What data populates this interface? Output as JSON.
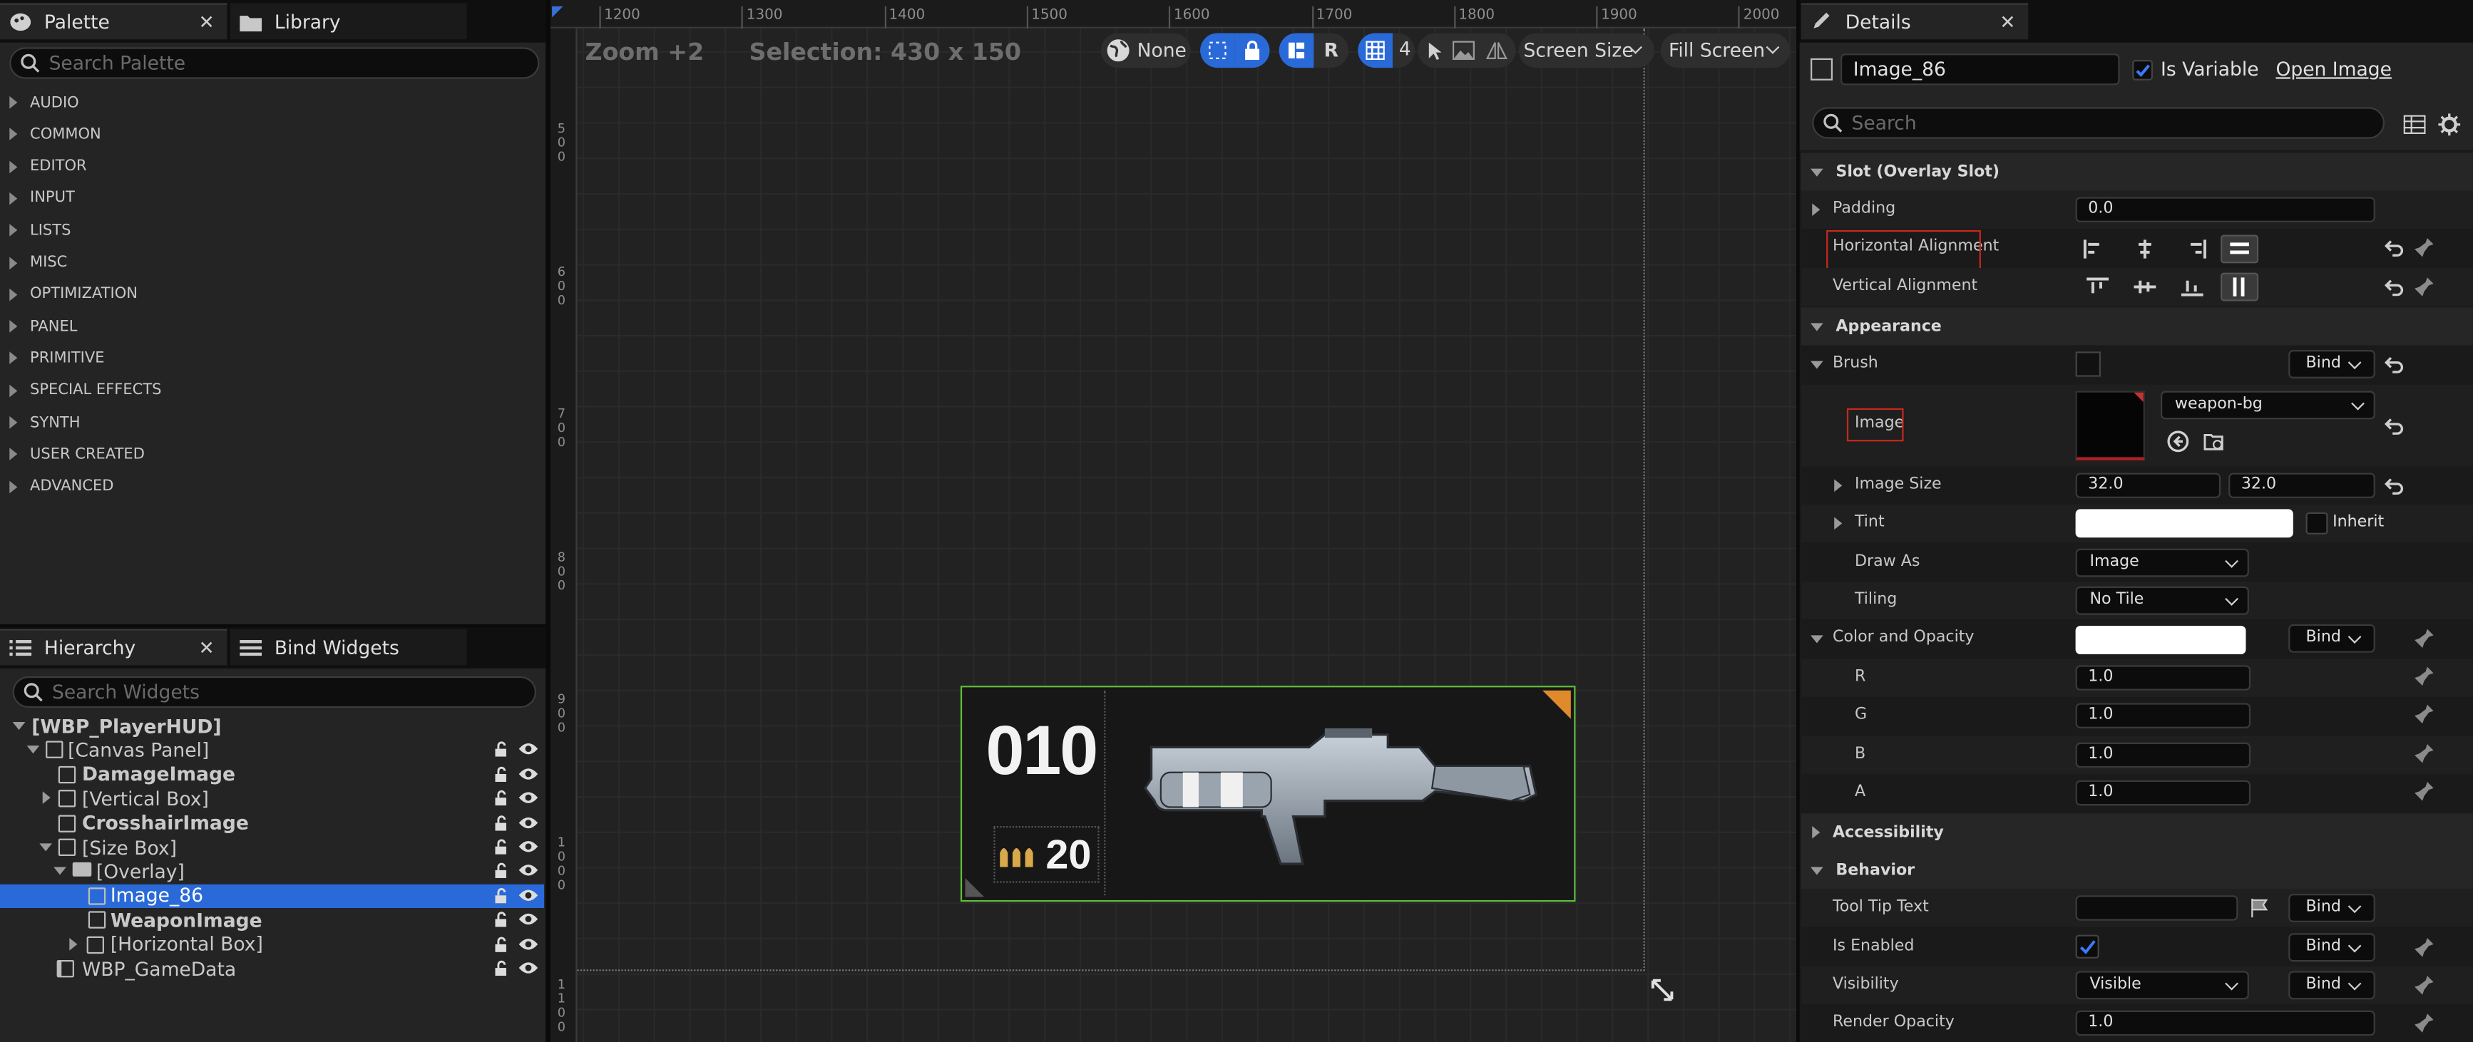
{
  "palette": {
    "tab_label": "Palette",
    "library_tab_label": "Library",
    "search_placeholder": "Search Palette",
    "categories": [
      "AUDIO",
      "COMMON",
      "EDITOR",
      "INPUT",
      "LISTS",
      "MISC",
      "OPTIMIZATION",
      "PANEL",
      "PRIMITIVE",
      "SPECIAL EFFECTS",
      "SYNTH",
      "USER CREATED",
      "ADVANCED"
    ]
  },
  "hierarchy": {
    "tab_label": "Hierarchy",
    "bind_widgets_tab_label": "Bind Widgets",
    "search_placeholder": "Search Widgets",
    "items": [
      {
        "label": "[WBP_PlayerHUD]"
      },
      {
        "label": "[Canvas Panel]"
      },
      {
        "label": "DamageImage"
      },
      {
        "label": "[Vertical Box]"
      },
      {
        "label": "CrosshairImage"
      },
      {
        "label": "[Size Box]"
      },
      {
        "label": "[Overlay]"
      },
      {
        "label": "Image_86"
      },
      {
        "label": "WeaponImage"
      },
      {
        "label": "[Horizontal Box]"
      },
      {
        "label": "WBP_GameData"
      }
    ]
  },
  "designer": {
    "zoom_label": "Zoom +2",
    "selection_label": "Selection: 430 x 150",
    "ruler_h": [
      "1200",
      "1300",
      "1400",
      "1500",
      "1600",
      "1700",
      "1800",
      "1900",
      "2000"
    ],
    "ruler_v": [
      "500",
      "600",
      "700",
      "800",
      "900",
      "1000",
      "1100"
    ],
    "toolbar": {
      "none_label": "None",
      "r_label": "R",
      "grid_value": "4",
      "screen_size_label": "Screen Size",
      "fill_screen_label": "Fill Screen"
    },
    "hud": {
      "magazine_ammo": "010",
      "reserve_ammo": "20"
    }
  },
  "details": {
    "tab_label": "Details",
    "widget_name": "Image_86",
    "is_variable_label": "Is Variable",
    "is_variable_checked": true,
    "open_image_label": "Open Image",
    "search_placeholder": "Search",
    "slot_section": "Slot (Overlay Slot)",
    "padding_label": "Padding",
    "padding_value": "0.0",
    "horizontal_alignment_label": "Horizontal Alignment",
    "vertical_alignment_label": "Vertical Alignment",
    "appearance_section": "Appearance",
    "brush_label": "Brush",
    "bind_label": "Bind",
    "image_label": "Image",
    "image_asset": "weapon-bg",
    "image_size_label": "Image Size",
    "image_size_x": "32.0",
    "image_size_y": "32.0",
    "tint_label": "Tint",
    "inherit_label": "Inherit",
    "draw_as_label": "Draw As",
    "draw_as_value": "Image",
    "tiling_label": "Tiling",
    "tiling_value": "No Tile",
    "color_opacity_label": "Color and Opacity",
    "r_label": "R",
    "r_value": "1.0",
    "g_label": "G",
    "g_value": "1.0",
    "b_label": "B",
    "b_value": "1.0",
    "a_label": "A",
    "a_value": "1.0",
    "accessibility_section": "Accessibility",
    "behavior_section": "Behavior",
    "tooltip_label": "Tool Tip Text",
    "is_enabled_label": "Is Enabled",
    "visibility_label": "Visibility",
    "visibility_value": "Visible",
    "render_opacity_label": "Render Opacity",
    "render_opacity_value": "1.0"
  },
  "colors": {
    "selection_blue": "#2a6ad8",
    "accent_orange": "#e08a2c",
    "highlight_red": "#c8281e",
    "selection_green": "#5fbf3a"
  }
}
